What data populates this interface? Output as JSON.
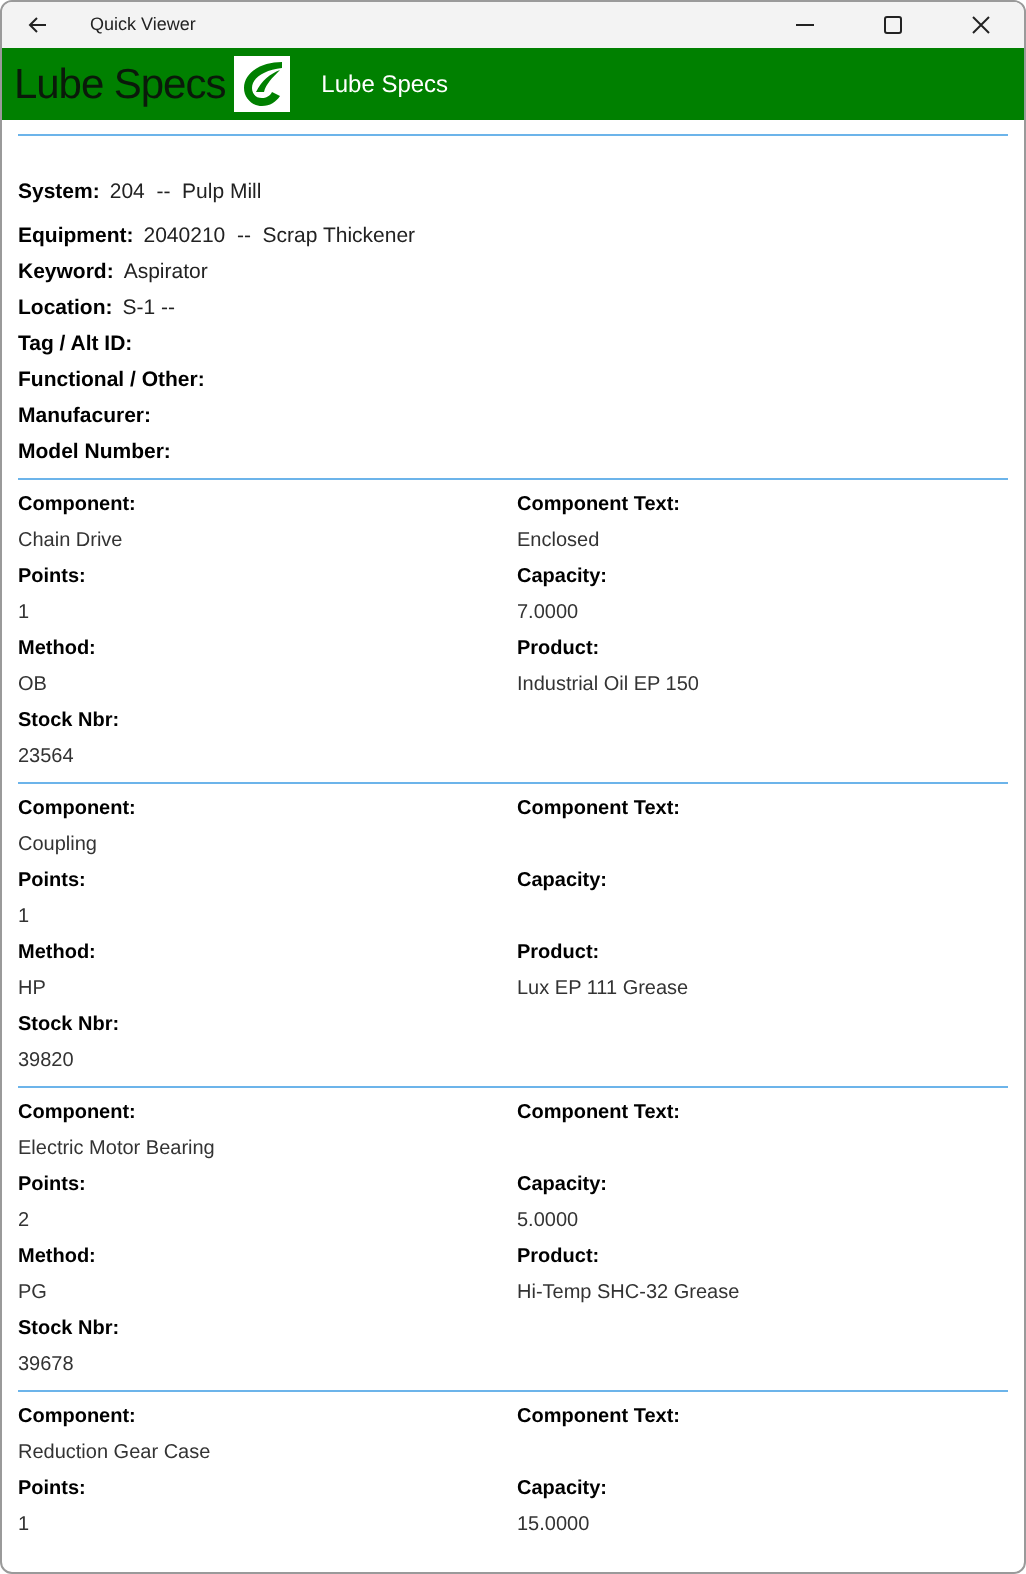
{
  "window": {
    "title": "Quick Viewer"
  },
  "header": {
    "logo_text": "Lube Specs",
    "title": "Lube Specs"
  },
  "info": [
    {
      "label": "System:",
      "value": "204  --  Pulp Mill"
    },
    {
      "label": "Equipment:",
      "value": "2040210  --  Scrap Thickener"
    },
    {
      "label": "Keyword:",
      "value": "Aspirator"
    },
    {
      "label": "Location:",
      "value": "S-1 --"
    },
    {
      "label": "Tag / Alt ID:"
    },
    {
      "label": "Functional / Other:"
    },
    {
      "label": "Manufacurer:"
    },
    {
      "label": "Model Number:"
    }
  ],
  "components": [
    {
      "left": [
        {
          "label": "Component:",
          "value": "Chain Drive"
        },
        {
          "label": "Points:",
          "value": "1"
        },
        {
          "label": "Method:",
          "value": "OB"
        },
        {
          "label": "Stock Nbr:",
          "value": "23564"
        }
      ],
      "right": [
        {
          "label": "Component Text:",
          "value": "Enclosed"
        },
        {
          "label": "Capacity:",
          "value": "7.0000"
        },
        {
          "label": "Product:",
          "value": "Industrial Oil EP 150"
        }
      ]
    },
    {
      "left": [
        {
          "label": "Component:",
          "value": "Coupling"
        },
        {
          "label": "Points:",
          "value": "1"
        },
        {
          "label": "Method:",
          "value": "HP"
        },
        {
          "label": "Stock Nbr:",
          "value": "39820"
        }
      ],
      "right": [
        {
          "label": "Component Text:"
        },
        {
          "label": "Capacity:"
        },
        {
          "label": "Product:",
          "value": "Lux EP 111 Grease"
        }
      ]
    },
    {
      "left": [
        {
          "label": "Component:",
          "value": "Electric Motor Bearing"
        },
        {
          "label": "Points:",
          "value": "2"
        },
        {
          "label": "Method:",
          "value": "PG"
        },
        {
          "label": "Stock Nbr:",
          "value": "39678"
        }
      ],
      "right": [
        {
          "label": "Component Text:"
        },
        {
          "label": "Capacity:",
          "value": "5.0000"
        },
        {
          "label": "Product:",
          "value": "Hi-Temp SHC-32 Grease"
        }
      ]
    },
    {
      "left": [
        {
          "label": "Component:",
          "value": "Reduction Gear Case"
        },
        {
          "label": "Points:",
          "value": "1"
        }
      ],
      "right": [
        {
          "label": "Component Text:"
        },
        {
          "label": "Capacity:",
          "value": "15.0000"
        }
      ]
    }
  ]
}
